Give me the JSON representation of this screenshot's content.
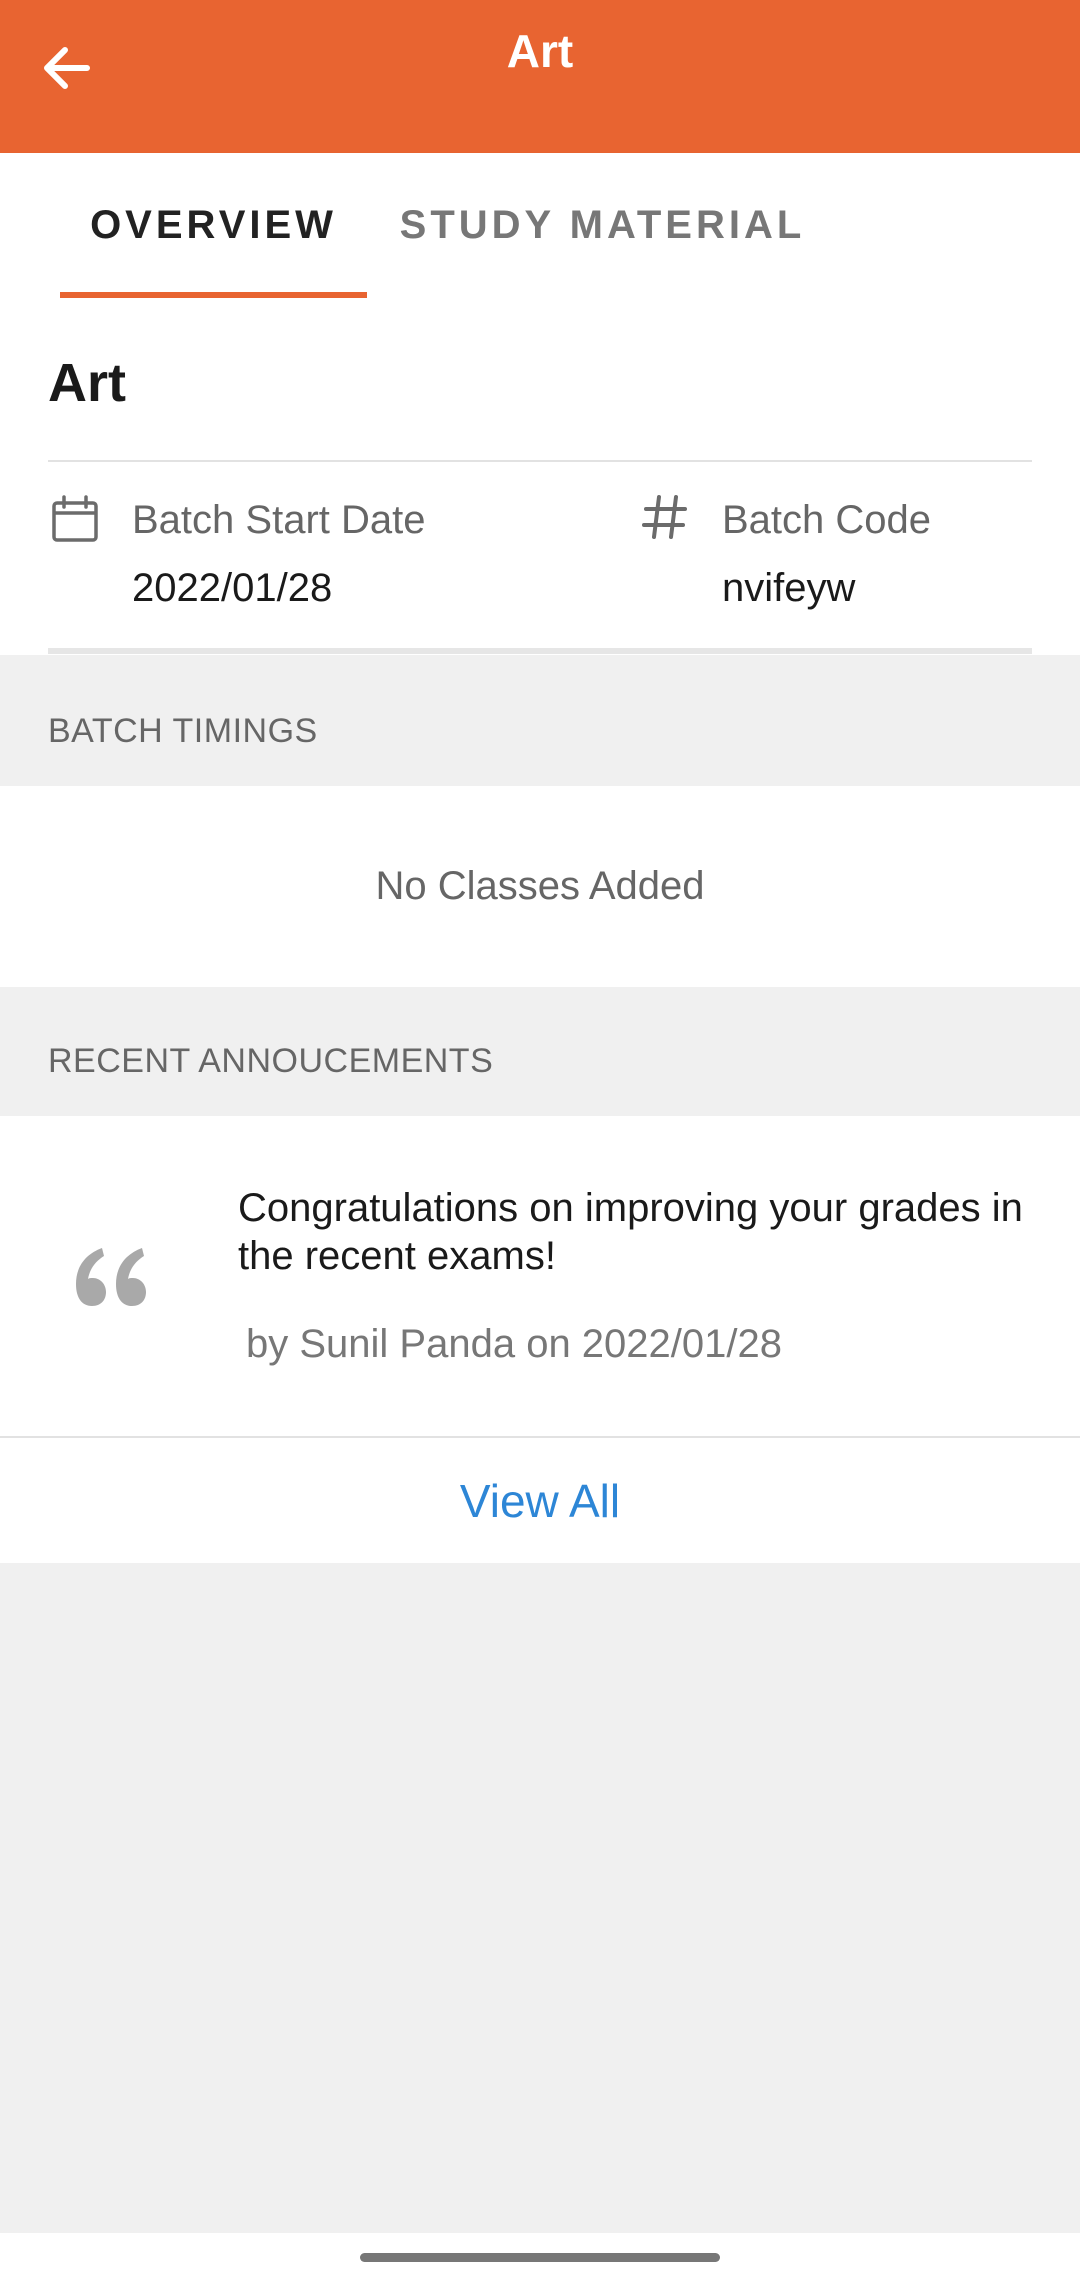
{
  "topbar": {
    "title": "Art",
    "back_icon": "arrow-left-icon",
    "color": "#e86431"
  },
  "tabs": [
    {
      "label": "OVERVIEW",
      "active": true
    },
    {
      "label": "STUDY MATERIAL",
      "active": false
    }
  ],
  "overview": {
    "course_title": "Art",
    "batch_start": {
      "icon": "calendar-icon",
      "label": "Batch Start Date",
      "value": "2022/01/28"
    },
    "batch_code": {
      "icon": "hash-icon",
      "label": "Batch Code",
      "value": "nvifeyw"
    }
  },
  "batch_timings": {
    "header": "BATCH TIMINGS",
    "empty_text": "No Classes Added"
  },
  "announcements": {
    "header": "RECENT ANNOUCEMENTS",
    "items": [
      {
        "icon": "quote-icon",
        "text": "Congratulations on improving your grades in the recent exams!",
        "meta": "by Sunil Panda on 2022/01/28"
      }
    ],
    "view_all_label": "View All",
    "link_color": "#2d86d6"
  }
}
